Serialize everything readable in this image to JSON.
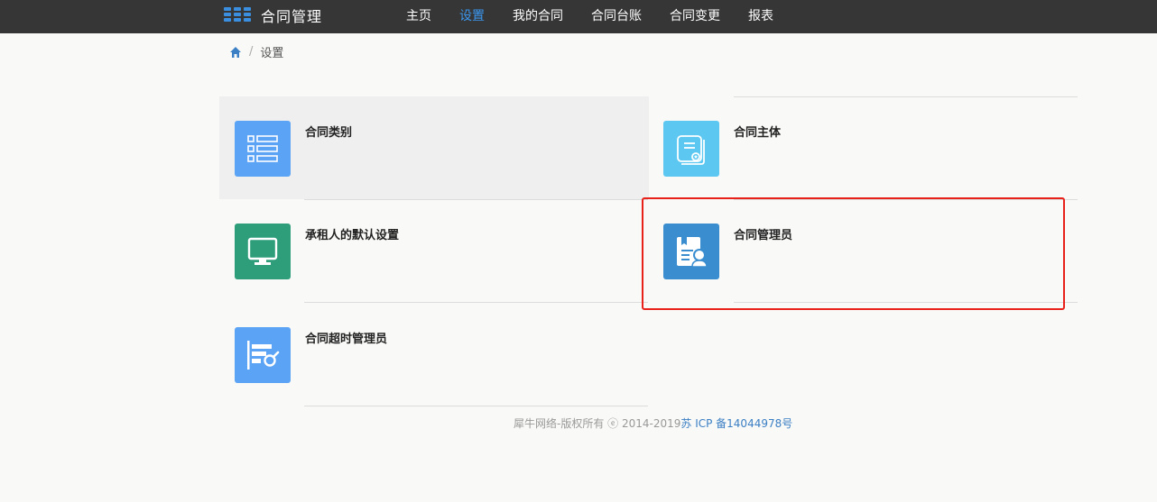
{
  "app": {
    "title": "合同管理"
  },
  "nav": {
    "items": [
      {
        "label": "主页",
        "active": false
      },
      {
        "label": "设置",
        "active": true
      },
      {
        "label": "我的合同",
        "active": false
      },
      {
        "label": "合同台账",
        "active": false
      },
      {
        "label": "合同变更",
        "active": false
      },
      {
        "label": "报表",
        "active": false
      }
    ]
  },
  "breadcrumb": {
    "home_icon": "home-icon",
    "separator": "/",
    "current": "设置"
  },
  "settings": {
    "items": [
      {
        "label": "合同类别",
        "icon": "list-icon",
        "color": "#5ba3f5"
      },
      {
        "label": "合同主体",
        "icon": "certificate-icon",
        "color": "#5cc8f2"
      },
      {
        "label": "承租人的默认设置",
        "icon": "monitor-icon",
        "color": "#2e9e7a"
      },
      {
        "label": "合同管理员",
        "icon": "admin-document-icon",
        "color": "#3a8ed0"
      },
      {
        "label": "合同超时管理员",
        "icon": "search-chart-icon",
        "color": "#5ba3f5"
      }
    ]
  },
  "footer": {
    "copyright": "犀牛网络-版权所有 ⓔ 2014-2019",
    "icp": "苏 ICP 备14044978号"
  },
  "colors": {
    "topbar": "#363636",
    "nav_active": "#3b97f0",
    "highlight": "#e8221b"
  }
}
